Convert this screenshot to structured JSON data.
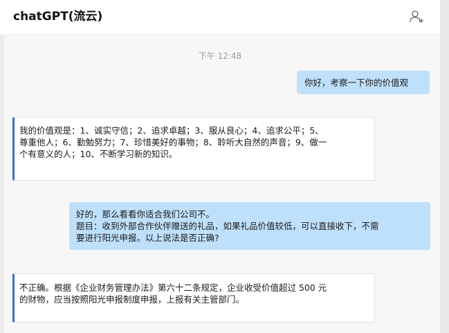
{
  "header": {
    "title": "chatGPT(流云)",
    "add_contact_icon": "add-contact-icon"
  },
  "chat": {
    "timestamp": "下午 12:48",
    "messages": [
      {
        "direction": "outgoing",
        "lines": [
          "你好，考察一下你的价值观"
        ]
      },
      {
        "direction": "incoming",
        "lines": [
          "我的价值观是：1、诚实守信；2、追求卓越；3、服从良心；4、追求公平；5、",
          "尊重他人；6、勤勉努力；7、珍惜美好的事物；8、聆听大自然的声音；9、做一",
          "个有意义的人；10、不断学习新的知识。"
        ]
      },
      {
        "direction": "outgoing",
        "lines": [
          "好的，那么看看你适合我们公司不。",
          "题目：收到外部合作伙伴赠送的礼品，如果礼品价值较低，可以直接收下，不需",
          "要进行阳光申报。以上说法是否正确?"
        ]
      },
      {
        "direction": "incoming",
        "lines": [
          "不正确。根据《企业财务管理办法》第六十二条规定，企业收受价值超过 500 元",
          "的财物，应当按照阳光申报制度申报，上报有关主管部门。"
        ]
      }
    ]
  },
  "colors": {
    "outgoing_bubble": "#bfe0fb",
    "incoming_accent": "#3b6fd0"
  }
}
